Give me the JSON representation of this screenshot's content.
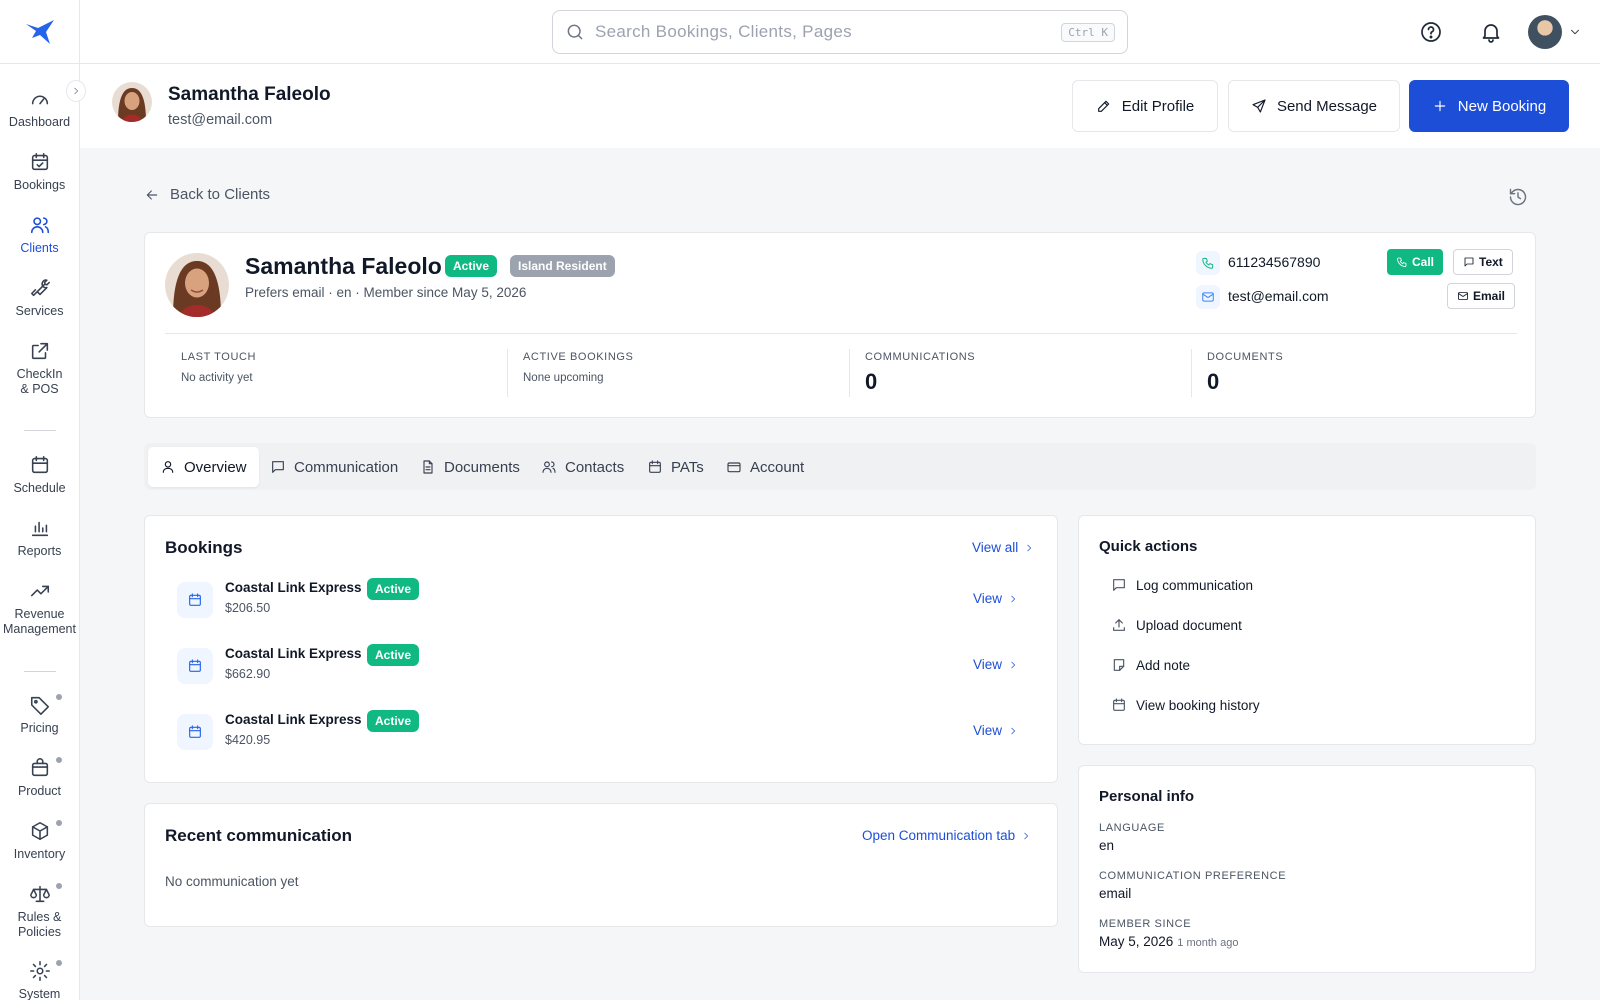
{
  "search": {
    "placeholder": "Search Bookings, Clients, Pages",
    "shortcut": "Ctrl K"
  },
  "sidebar": {
    "items": [
      {
        "label": "Dashboard",
        "icon": "gauge-icon"
      },
      {
        "label": "Bookings",
        "icon": "calendar-check-icon"
      },
      {
        "label": "Clients",
        "icon": "users-icon",
        "active": true
      },
      {
        "label": "Services",
        "icon": "wrench-icon"
      },
      {
        "label": "CheckIn & POS",
        "icon": "external-link-icon"
      },
      {
        "label": "Schedule",
        "icon": "calendar-icon"
      },
      {
        "label": "Reports",
        "icon": "bar-chart-icon"
      },
      {
        "label": "Revenue Management",
        "icon": "trending-up-icon"
      },
      {
        "label": "Pricing",
        "icon": "tag-icon"
      },
      {
        "label": "Product",
        "icon": "shopping-bag-icon"
      },
      {
        "label": "Inventory",
        "icon": "box-icon"
      },
      {
        "label": "Rules & Policies",
        "icon": "scale-icon"
      },
      {
        "label": "System",
        "icon": "gear-icon"
      }
    ]
  },
  "profile_header": {
    "name": "Samantha Faleolo",
    "email": "test@email.com",
    "edit_label": "Edit Profile",
    "message_label": "Send Message",
    "new_booking_label": "New Booking"
  },
  "back_label": "Back to Clients",
  "summary": {
    "name": "Samantha Faleolo",
    "status_badge": "Active",
    "resident_badge": "Island Resident",
    "subtitle": "Prefers email · en · Member since May 5, 2026",
    "phone": "611234567890",
    "email": "test@email.com",
    "call_label": "Call",
    "text_label": "Text",
    "email_label": "Email",
    "stats": [
      {
        "label": "LAST TOUCH",
        "value": "No activity yet"
      },
      {
        "label": "ACTIVE BOOKINGS",
        "value": "None upcoming"
      },
      {
        "label": "COMMUNICATIONS",
        "value": "0"
      },
      {
        "label": "DOCUMENTS",
        "value": "0"
      }
    ]
  },
  "tabs": [
    "Overview",
    "Communication",
    "Documents",
    "Contacts",
    "PATs",
    "Account"
  ],
  "bookings": {
    "title": "Bookings",
    "view_all": "View all",
    "items": [
      {
        "name": "Coastal Link Express",
        "status": "Active",
        "price": "$206.50",
        "action": "View"
      },
      {
        "name": "Coastal Link Express",
        "status": "Active",
        "price": "$662.90",
        "action": "View"
      },
      {
        "name": "Coastal Link Express",
        "status": "Active",
        "price": "$420.95",
        "action": "View"
      }
    ]
  },
  "recent": {
    "title": "Recent communication",
    "link": "Open Communication tab",
    "empty": "No communication yet"
  },
  "quick_actions": {
    "title": "Quick actions",
    "items": [
      "Log communication",
      "Upload document",
      "Add note",
      "View booking history"
    ]
  },
  "personal": {
    "title": "Personal info",
    "language_label": "LANGUAGE",
    "language": "en",
    "pref_label": "COMMUNICATION PREFERENCE",
    "pref": "email",
    "since_label": "MEMBER SINCE",
    "since": "May 5, 2026",
    "since_relative": "1 month ago"
  },
  "colors": {
    "primary": "#1d4ed8",
    "success": "#10b981",
    "badge_gray": "#9ca3af"
  }
}
